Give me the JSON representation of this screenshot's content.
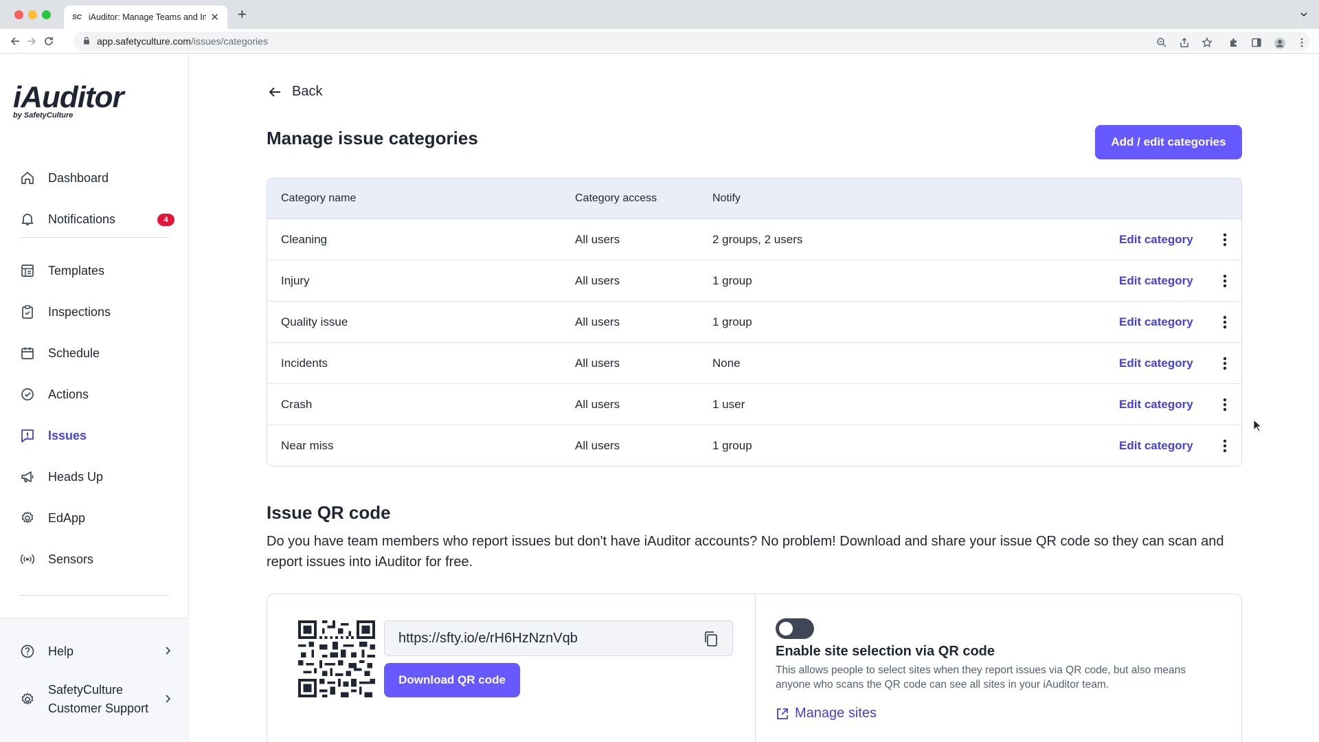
{
  "browser": {
    "tab_title": "iAuditor: Manage Teams and In",
    "tab_favicon": "SC",
    "url_host": "app.safetyculture.com",
    "url_path": "/issues/categories"
  },
  "sidebar": {
    "brand": "iAuditor",
    "brand_sub": "by SafetyCulture",
    "notifications_count": "4",
    "items": [
      {
        "label": "Dashboard",
        "icon": "home-icon"
      },
      {
        "label": "Notifications",
        "icon": "bell-icon"
      },
      {
        "label": "Templates",
        "icon": "template-icon"
      },
      {
        "label": "Inspections",
        "icon": "clipboard-icon"
      },
      {
        "label": "Schedule",
        "icon": "calendar-icon"
      },
      {
        "label": "Actions",
        "icon": "check-circle-icon"
      },
      {
        "label": "Issues",
        "icon": "issue-icon"
      },
      {
        "label": "Heads Up",
        "icon": "megaphone-icon"
      },
      {
        "label": "EdApp",
        "icon": "gear-badge-icon"
      },
      {
        "label": "Sensors",
        "icon": "sensor-icon"
      }
    ],
    "help_label": "Help",
    "org_name": "SafetyCulture",
    "org_sub": "Customer Support"
  },
  "main": {
    "back_label": "Back",
    "title": "Manage issue categories",
    "add_button": "Add / edit categories",
    "table": {
      "headers": [
        "Category name",
        "Category access",
        "Notify"
      ],
      "edit_label": "Edit category",
      "rows": [
        {
          "name": "Cleaning",
          "access": "All users",
          "notify": "2 groups, 2 users"
        },
        {
          "name": "Injury",
          "access": "All users",
          "notify": "1 group"
        },
        {
          "name": "Quality issue",
          "access": "All users",
          "notify": "1 group"
        },
        {
          "name": "Incidents",
          "access": "All users",
          "notify": "None"
        },
        {
          "name": "Crash",
          "access": "All users",
          "notify": "1 user"
        },
        {
          "name": "Near miss",
          "access": "All users",
          "notify": "1 group"
        }
      ]
    },
    "qr": {
      "title": "Issue QR code",
      "description": "Do you have team members who report issues but don't have iAuditor accounts? No problem! Download and share your issue QR code so they can scan and report issues into iAuditor for free.",
      "url": "https://sfty.io/e/rH6HzNznVqb",
      "download_button": "Download QR code",
      "toggle_on": false,
      "site_title": "Enable site selection via QR code",
      "site_desc": "This allows people to select sites when they report issues via QR code, but also means anyone who scans the QR code can see all sites in your iAuditor team.",
      "manage_sites": "Manage sites"
    }
  },
  "colors": {
    "accent": "#6559ff",
    "link": "#4740d4",
    "badge": "#e5153a",
    "table_header": "#e9eef9"
  }
}
